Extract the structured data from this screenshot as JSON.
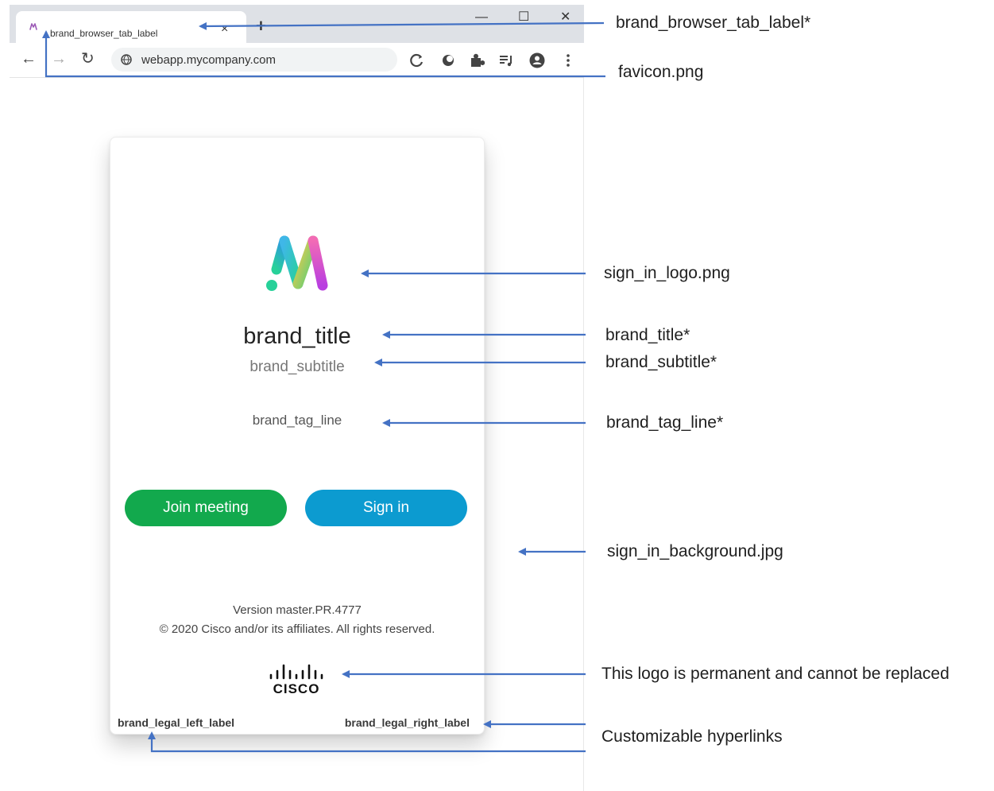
{
  "browser": {
    "tab": {
      "label": "brand_browser_tab_label",
      "close_glyph": "×"
    },
    "new_tab_glyph": "+",
    "window_controls": {
      "minimize": "—",
      "maximize": "☐",
      "close": "✕"
    },
    "nav": {
      "back": "←",
      "forward": "→",
      "reload": "↻"
    },
    "address_bar": {
      "url": "webapp.mycompany.com"
    },
    "extensions": [
      "refresh-circle-icon",
      "moon-icon",
      "puzzle-icon",
      "playlist-icon",
      "account-icon",
      "kebab-menu-icon"
    ]
  },
  "card": {
    "title": "brand_title",
    "subtitle": "brand_subtitle",
    "tagline": "brand_tag_line",
    "buttons": {
      "join": "Join meeting",
      "signin": "Sign in"
    },
    "version": "Version master.PR.4777",
    "copyright": "© 2020 Cisco and/or its affiliates. All rights reserved.",
    "cisco_logo_text": "CISCO",
    "legal_left": "brand_legal_left_label",
    "legal_right": "brand_legal_right_label"
  },
  "annotations": {
    "tab_label": "brand_browser_tab_label*",
    "favicon": "favicon.png",
    "logo": "sign_in_logo.png",
    "title": "brand_title*",
    "subtitle": "brand_subtitle*",
    "tagline": "brand_tag_line*",
    "background": "sign_in_background.jpg",
    "cisco_logo": "This logo is permanent and cannot be replaced",
    "hyperlinks": "Customizable hyperlinks"
  },
  "colors": {
    "join_button": "#12a94d",
    "signin_button": "#0c9bd0",
    "annotation_arrow": "#4472c4",
    "tabstrip": "#dee1e6",
    "logo_gradient": [
      "#2d9cdb",
      "#27d199",
      "#f2c94c",
      "#d63ad6"
    ]
  }
}
